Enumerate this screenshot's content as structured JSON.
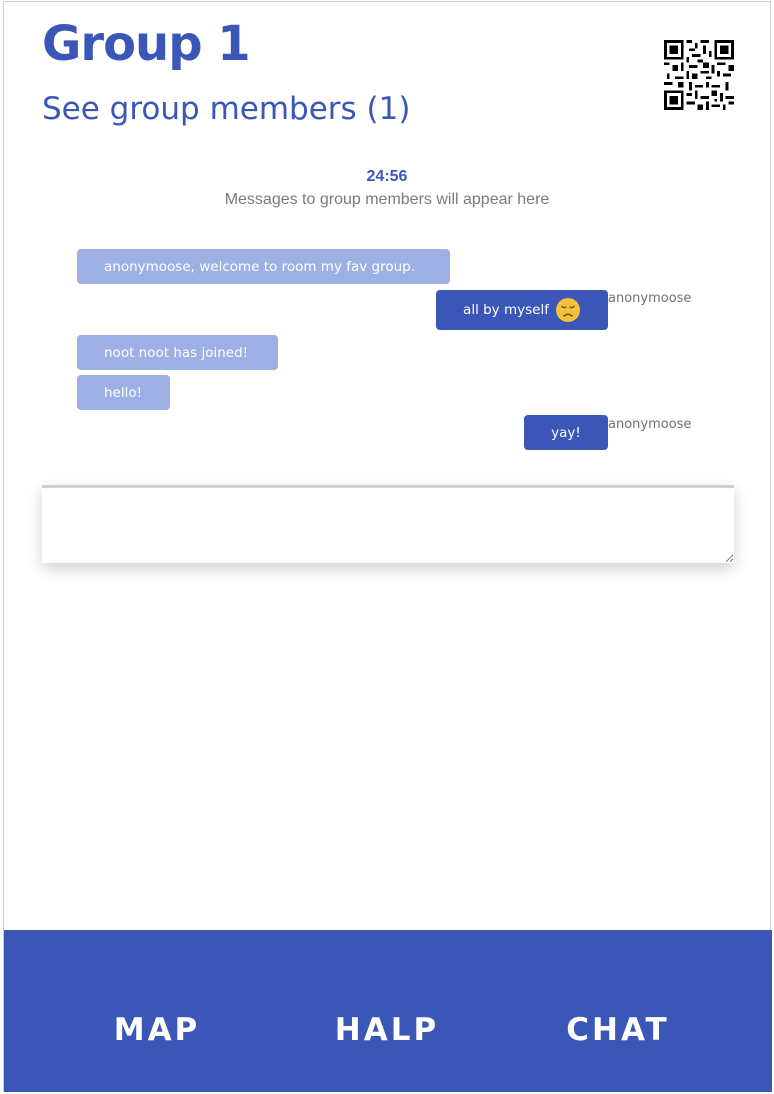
{
  "header": {
    "title": "Group 1",
    "members_link": "See group members (1)",
    "qr_icon": "qr-code-icon"
  },
  "chat": {
    "timer": "24:56",
    "hint": "Messages to group members will appear here",
    "messages": [
      {
        "direction": "incoming",
        "text": "anonymoose, welcome to room my fav group.",
        "sender": ""
      },
      {
        "direction": "outgoing",
        "text": "all by myself",
        "emoji": "disappointed-face-icon",
        "sender": "anonymoose"
      },
      {
        "direction": "incoming",
        "text": "noot noot has joined!",
        "sender": ""
      },
      {
        "direction": "incoming",
        "text": "hello!",
        "sender": ""
      },
      {
        "direction": "outgoing",
        "text": "yay!",
        "sender": "anonymoose"
      }
    ],
    "input_value": ""
  },
  "nav": {
    "items": [
      {
        "label": "MAP"
      },
      {
        "label": "HALP"
      },
      {
        "label": "CHAT"
      }
    ]
  },
  "colors": {
    "accent": "#3a57b7",
    "incoming_bubble": "#9db0e3",
    "outgoing_bubble": "#3a57b7"
  }
}
